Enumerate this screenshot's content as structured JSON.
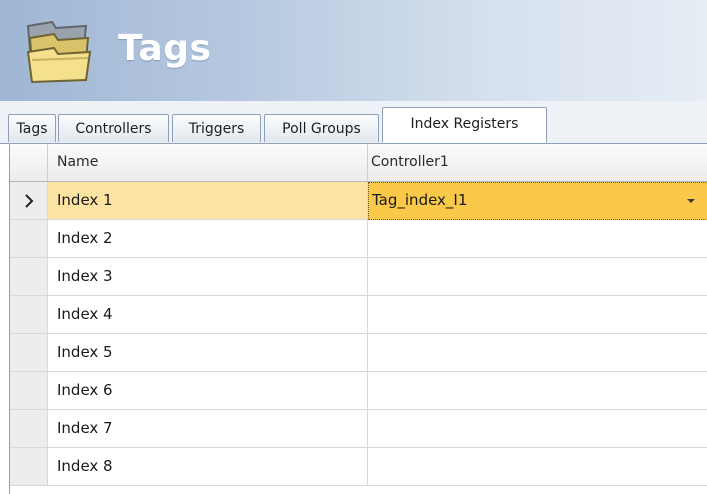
{
  "header": {
    "title": "Tags"
  },
  "tabs": [
    {
      "label": "Tags"
    },
    {
      "label": "Controllers"
    },
    {
      "label": "Triggers"
    },
    {
      "label": "Poll Groups"
    },
    {
      "label": "Index Registers",
      "active": true
    }
  ],
  "grid": {
    "columns": [
      {
        "label": "Name"
      },
      {
        "label": "Controller1"
      }
    ],
    "rows": [
      {
        "name": "Index 1",
        "controller": "Tag_index_I1",
        "current": true
      },
      {
        "name": "Index 2",
        "controller": ""
      },
      {
        "name": "Index 3",
        "controller": ""
      },
      {
        "name": "Index 4",
        "controller": ""
      },
      {
        "name": "Index 5",
        "controller": ""
      },
      {
        "name": "Index 6",
        "controller": ""
      },
      {
        "name": "Index 7",
        "controller": ""
      },
      {
        "name": "Index 8",
        "controller": ""
      }
    ]
  },
  "icons": {
    "header": "tags-stack-icon",
    "row_indicator": "current-row-arrow-icon",
    "dropdown": "chevron-down-icon"
  },
  "colors": {
    "header_gradient_start": "#9fb6d4",
    "selected_cell": "#fbc94a",
    "selected_row": "#fbe3a2",
    "title_text": "#ffffff"
  }
}
